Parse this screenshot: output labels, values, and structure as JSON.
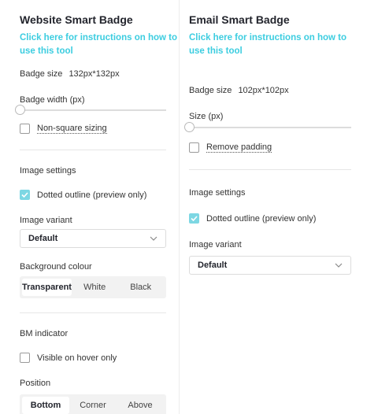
{
  "website": {
    "title": "Website Smart Badge",
    "instructions_line1": "Click here for instructions on how to",
    "instructions_line2": "use this tool",
    "badge_size_label": "Badge size",
    "badge_size_value": "132px*132px",
    "badge_width_label": "Badge width (px)",
    "non_square_label": "Non-square sizing",
    "image_settings_label": "Image settings",
    "dotted_outline_label": "Dotted outline (preview only)",
    "dotted_outline_checked": true,
    "image_variant_label": "Image variant",
    "image_variant_value": "Default",
    "background_colour_label": "Background colour",
    "background_options": [
      "Transparent",
      "White",
      "Black"
    ],
    "background_selected": "Transparent",
    "bm_indicator_label": "BM indicator",
    "visible_on_hover_label": "Visible on hover only",
    "position_label": "Position",
    "position_options": [
      "Bottom",
      "Corner",
      "Above"
    ],
    "position_selected": "Bottom"
  },
  "email": {
    "title": "Email Smart Badge",
    "instructions_line1": "Click here for instructions on how to",
    "instructions_line2": "use this tool",
    "badge_size_label": "Badge size",
    "badge_size_value": "102px*102px",
    "size_label": "Size (px)",
    "remove_padding_label": "Remove padding",
    "image_settings_label": "Image settings",
    "dotted_outline_label": "Dotted outline (preview only)",
    "dotted_outline_checked": true,
    "image_variant_label": "Image variant",
    "image_variant_value": "Default"
  },
  "colors": {
    "accent_link": "#3ccde0",
    "checkbox_checked": "#7dd7e3"
  }
}
